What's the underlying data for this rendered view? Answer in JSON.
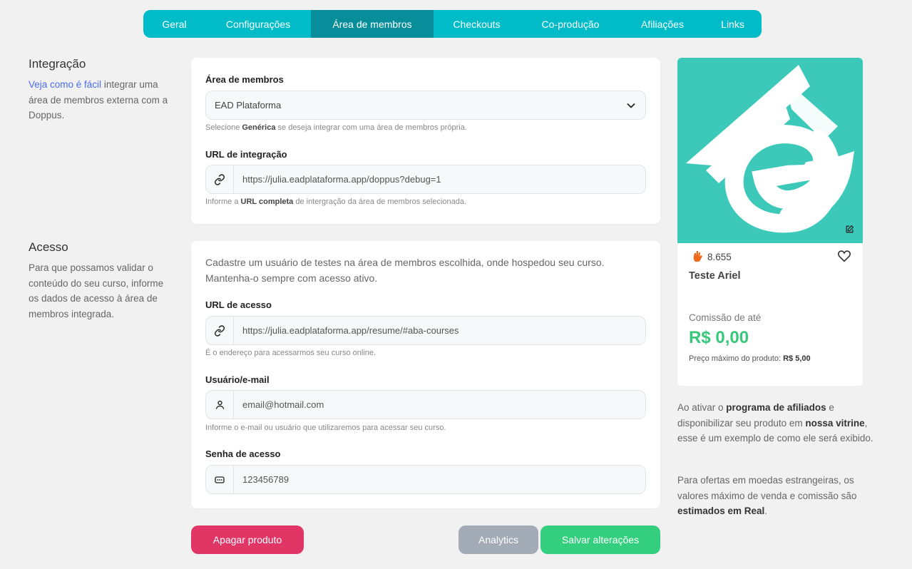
{
  "tabs": [
    "Geral",
    "Configurações",
    "Área de membros",
    "Checkouts",
    "Co-produção",
    "Afiliações",
    "Links"
  ],
  "integration": {
    "title": "Integração",
    "desc_link": "Veja como é fácil",
    "desc_rest": " integrar uma área de membros externa com a Doppus.",
    "members_label": "Área de membros",
    "members_value": "EAD Plataforma",
    "members_hint_pre": "Selecione ",
    "members_hint_bold": "Genérica",
    "members_hint_post": " se deseja integrar com uma área de membros própria.",
    "url_label": "URL de integração",
    "url_value": "https://julia.eadplataforma.app/doppus?debug=1",
    "url_hint_pre": "Informe a ",
    "url_hint_bold": "URL completa",
    "url_hint_post": " de intergração da área de membros selecionada."
  },
  "access": {
    "title": "Acesso",
    "desc": "Para que possamos validar o conteúdo do seu curso, informe os dados de acesso à área de membros integrada.",
    "intro": "Cadastre um usuário de testes na área de membros escolhida, onde hospedou seu curso. Mantenha-o sempre com acesso ativo.",
    "url_label": "URL de acesso",
    "url_value": "https://julia.eadplataforma.app/resume/#aba-courses",
    "url_hint": "É o endereço para acessarmos seu curso online.",
    "user_label": "Usuário/e-mail",
    "user_value": "email@hotmail.com",
    "user_hint": "Informe o e-mail ou usuário que utilizaremos para acessar seu curso.",
    "pass_label": "Senha de acesso",
    "pass_value": "123456789"
  },
  "buttons": {
    "delete": "Apagar produto",
    "analytics": "Analytics",
    "save": "Salvar alterações"
  },
  "product": {
    "rating": "8.655",
    "name": "Teste Ariel",
    "commission_label": "Comissão de até",
    "commission_value": "R$ 0,00",
    "max_price_label": "Preço máximo do produto: ",
    "max_price_value": "R$ 5,00"
  },
  "aside": {
    "p1_a": "Ao ativar o ",
    "p1_b": "programa de afiliados",
    "p1_c": " e disponibilizar seu produto em ",
    "p1_d": "nossa vitrine",
    "p1_e": ", esse é um exemplo de como ele será exibido.",
    "p2_a": "Para ofertas em moedas estrangeiras, os valores máximo de venda e comissão são ",
    "p2_b": "estimados em Real",
    "p2_c": "."
  },
  "colors": {
    "tab_bg": "#00bcc9",
    "tab_active": "#078e9a",
    "delete": "#e03565",
    "analytics": "#a3abb6",
    "save": "#33cf7f",
    "product_bg": "#3cc9b9",
    "commission": "#37c87a"
  }
}
